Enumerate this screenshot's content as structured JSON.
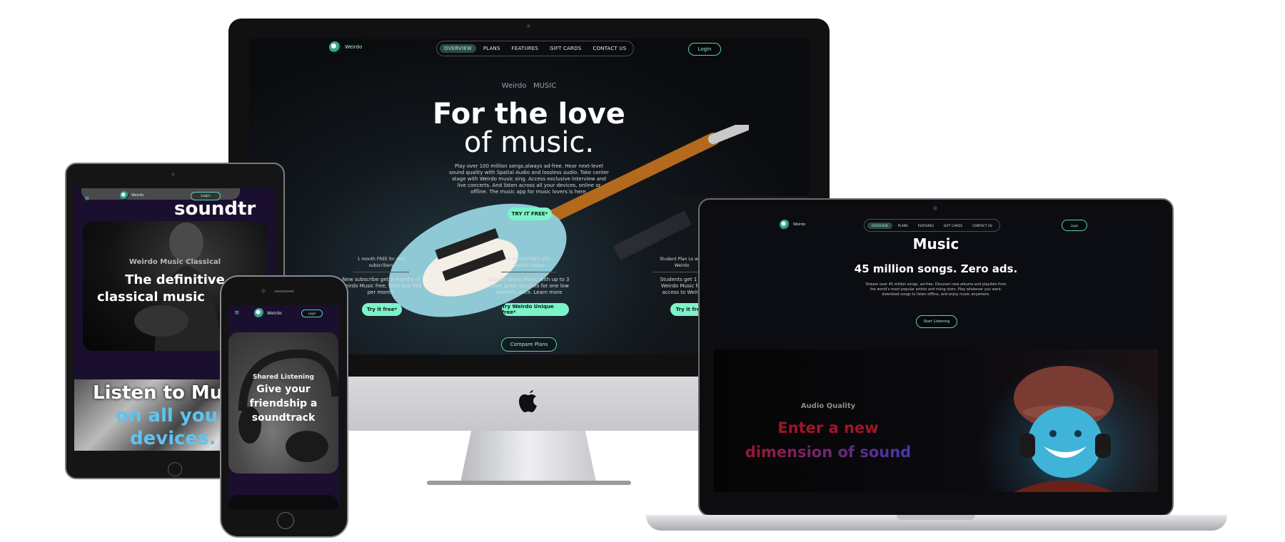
{
  "desktop": {
    "brand": "Weirdo",
    "nav": [
      {
        "label": "OVERVIEW",
        "active": true
      },
      {
        "label": "PLANS",
        "active": false
      },
      {
        "label": "FEATURES",
        "active": false
      },
      {
        "label": "GIFT CARDS",
        "active": false
      },
      {
        "label": "CONTACT US",
        "active": false
      }
    ],
    "login": "Login",
    "eyebrow": "Weirdo   MUSIC",
    "headline_1": "For the love",
    "headline_2": "of music.",
    "description": "Play over 100 million songs,always ad-free. Hear next-level sound quality with Spatial Audio and lossless audio. Take center stage with Weirdo music sing. Access exclusive interview and live concerts. And listen across all your devices, online or offline. The music app for music lovers is here.",
    "cta": "TRY IT FREE*",
    "plans": [
      {
        "title": "1 month FREE for new subscribers",
        "desc": "New subscribe get 3 months of Weirdo Music free, then pay 99$ per month.",
        "button": "Try it free*"
      },
      {
        "title": "3 months FREE with Weirdo Unique",
        "desc": "Bundle Weird Music with up to 3 other great services for one low monthly price. Learn more",
        "button": "Try Weirdo Unique free*"
      },
      {
        "title": "Student Plan Lo with Weirdo",
        "desc": "Students get 1 m Weirdo Music fre access to Weird",
        "button": "Try it free"
      }
    ],
    "compare": "Compare Plans"
  },
  "laptop": {
    "brand": "Weirdo",
    "nav": [
      "OVERVIEW",
      "PLANS",
      "FEATURES",
      "GIFT CARDS",
      "CONTACT US"
    ],
    "login": "Login",
    "title": "Music",
    "subtitle": "45 million songs. Zero ads.",
    "desc": "Stream over 45 million songs, ad-free. Discover new albums and playlists from the world’s most popular artists and rising stars. Play whatever you want, download songs to listen offline, and enjoy music anywhere.",
    "cta": "Start Listening",
    "section_eyebrow": "Audio Quality",
    "section_title_1": "Enter a new",
    "section_title_2": "dimension of sound"
  },
  "tablet": {
    "brand": "Weirdo",
    "login": "Login",
    "top_text": "soundtr",
    "card_eyebrow": "Weirdo Music Classical",
    "card_title_1": "The definitive",
    "card_title_2": "classical music",
    "listen_1": "Listen to Mu",
    "listen_2": "on all you",
    "listen_3": "devices."
  },
  "phone": {
    "brand": "Weirdo",
    "login": "Login",
    "card_eyebrow": "Shared Listening",
    "card_title_1": "Give your",
    "card_title_2": "friendship a",
    "card_title_3": "soundtrack"
  },
  "colors": {
    "accent": "#7ef2c9",
    "bg_dark": "#0e1014",
    "tablet_bg": "#1a0f2e",
    "sound_red": "#a0152a",
    "sound_blue": "#2b3fb5"
  }
}
